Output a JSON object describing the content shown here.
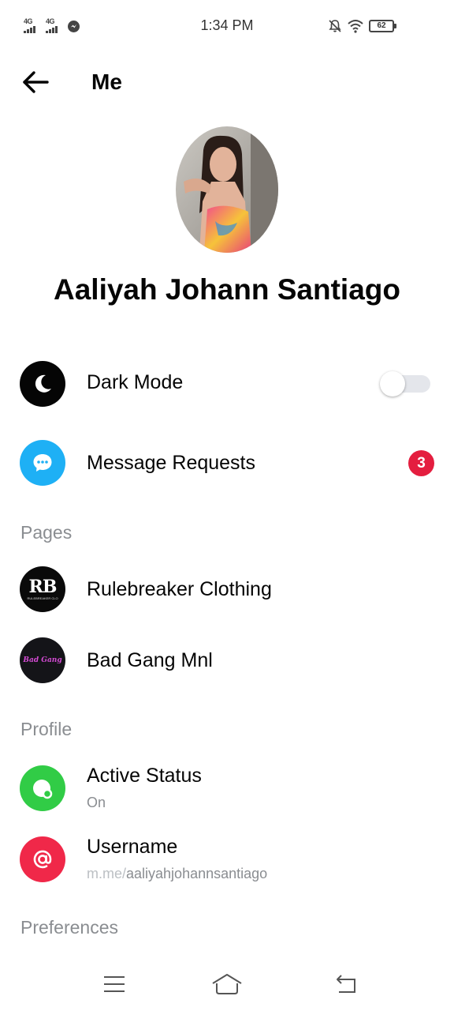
{
  "status_bar": {
    "network_1": "4G",
    "network_2": "4G",
    "time": "1:34 PM",
    "battery": "62",
    "icons": [
      "signal-icon",
      "signal-icon",
      "messenger-icon",
      "bell-off-icon",
      "wifi-icon",
      "battery-icon"
    ]
  },
  "header": {
    "title": "Me",
    "back_icon": "arrow-left-icon"
  },
  "profile": {
    "name": "Aaliyah Johann Santiago"
  },
  "settings": {
    "dark_mode": {
      "label": "Dark Mode",
      "icon": "moon-icon",
      "enabled": false
    },
    "message_requests": {
      "label": "Message Requests",
      "icon": "chat-bubble-icon",
      "badge": "3"
    }
  },
  "sections": {
    "pages": "Pages",
    "profile": "Profile",
    "preferences": "Preferences"
  },
  "pages": [
    {
      "label": "Rulebreaker Clothing",
      "logo_text": "RB",
      "logo_sub": "RULEBREAKER CLO"
    },
    {
      "label": "Bad Gang Mnl",
      "logo_text": "Bad Gang"
    }
  ],
  "profile_items": {
    "active_status": {
      "label": "Active Status",
      "value": "On",
      "icon": "active-status-icon"
    },
    "username": {
      "label": "Username",
      "prefix": "m.me/",
      "value": "aaliyahjohannsantiago",
      "icon": "at-sign-icon"
    }
  },
  "colors": {
    "accent_blue": "#1eb0f5",
    "active_green": "#31cc46",
    "username_red": "#f02849",
    "badge_red": "#e41e3f",
    "section_gray": "#8a8d91"
  },
  "nav": {
    "icons": [
      "menu-icon",
      "home-icon",
      "back-icon"
    ]
  }
}
